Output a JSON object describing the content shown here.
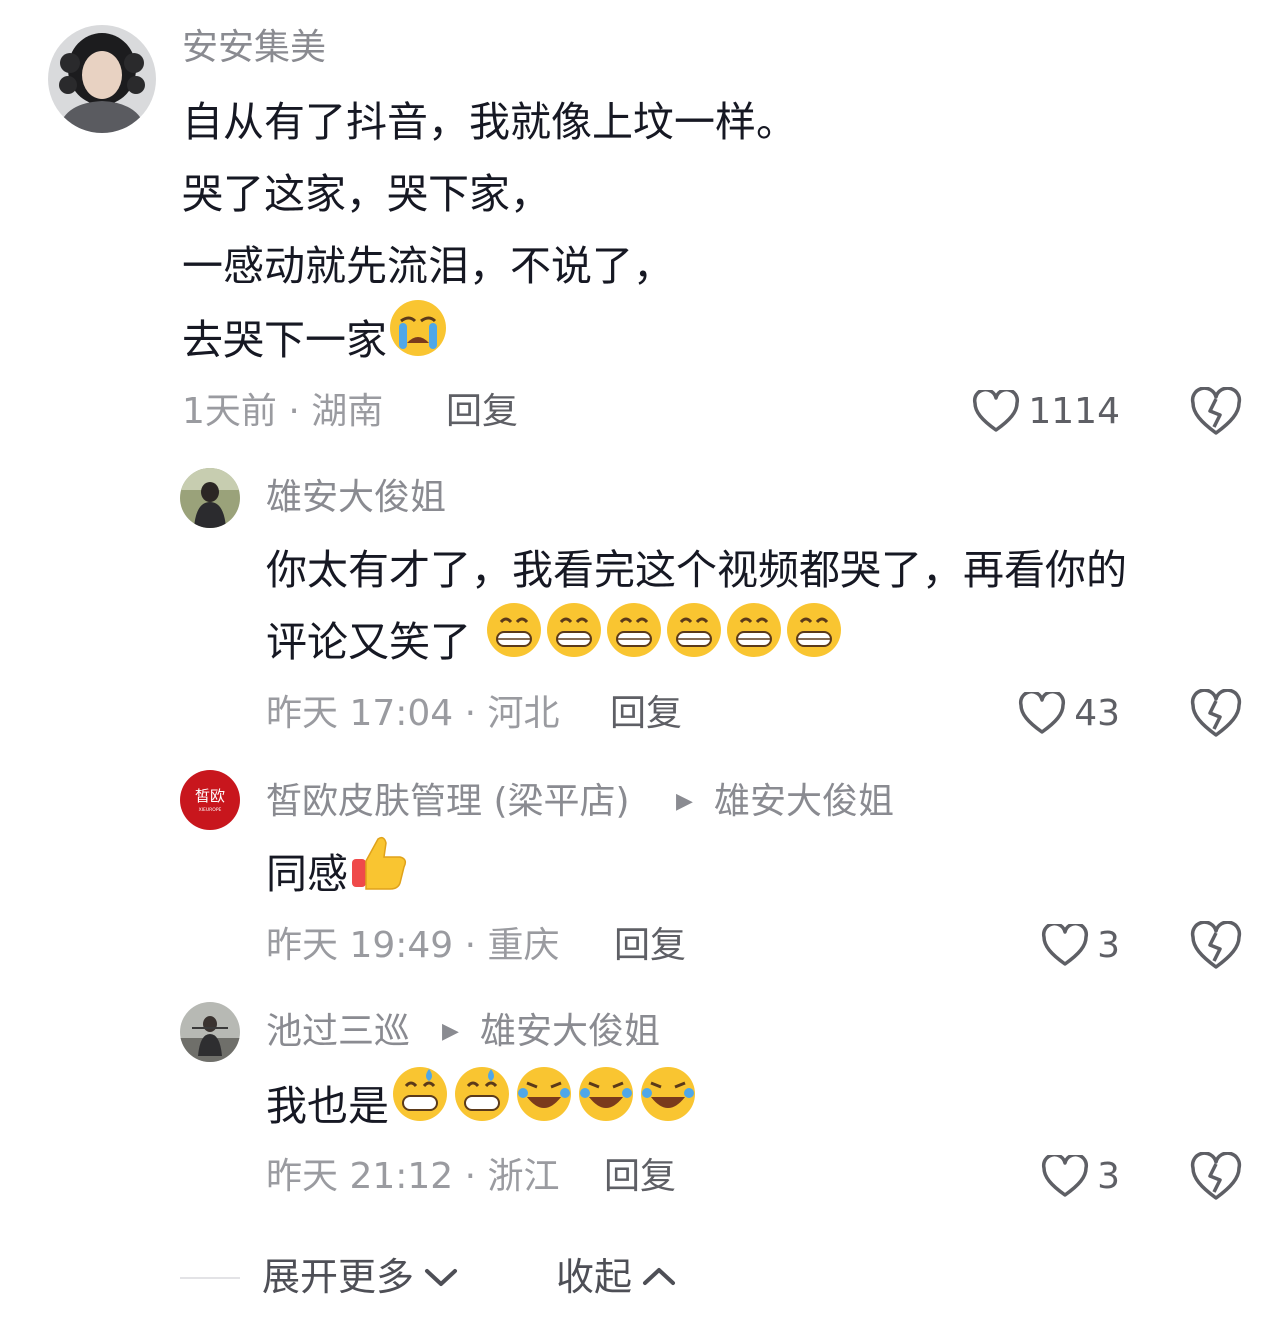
{
  "comments": [
    {
      "username": "安安集美",
      "lines": [
        "自从有了抖音，我就像上坟一样。",
        "哭了这家，哭下家，",
        "一感动就先流泪，不说了，",
        "去哭下一家"
      ],
      "line_emojis": [
        "",
        "",
        "",
        "loudly-crying"
      ],
      "meta": "1天前 · 湖南",
      "reply": "回复",
      "likes": "1114"
    },
    {
      "username": "雄安大俊姐",
      "lines": [
        "你太有才了，我看完这个视频都哭了，再看你的",
        "评论又笑了"
      ],
      "emojis": [
        "grinning",
        "grinning",
        "grinning",
        "grinning",
        "grinning",
        "grinning"
      ],
      "meta": "昨天 17:04 · 河北",
      "reply": "回复",
      "likes": "43"
    },
    {
      "username": "皙欧皮肤管理 (梁平店)",
      "reply_to": "雄安大俊姐",
      "avatar_logo_text": "皙欧",
      "avatar_logo_sub": "XIEUROPE",
      "lines": [
        "同感"
      ],
      "emojis": [
        "thumbs-up"
      ],
      "meta": "昨天 19:49 · 重庆",
      "reply": "回复",
      "likes": "3"
    },
    {
      "username": "池过三巡",
      "reply_to": "雄安大俊姐",
      "lines": [
        "我也是"
      ],
      "emojis": [
        "grinning-sweat",
        "grinning-sweat",
        "rofl",
        "rofl",
        "rofl"
      ],
      "meta": "昨天 21:12 · 浙江",
      "reply": "回复",
      "likes": "3"
    }
  ],
  "footer": {
    "expand_more": "展开更多",
    "collapse": "收起"
  },
  "colors": {
    "username": "#8a8b91",
    "body": "#161823",
    "meta": "#9a9ba0",
    "logo_red": "#c8161d"
  }
}
